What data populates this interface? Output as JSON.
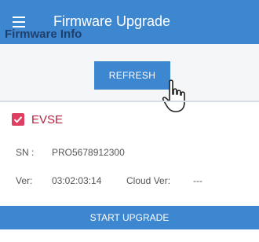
{
  "header": {
    "title": "Firmware Upgrade"
  },
  "firmware_info": {
    "label": "Firmware Info",
    "refresh_label": "REFRESH"
  },
  "device": {
    "name": "EVSE",
    "checked": true,
    "sn_label": "SN :",
    "sn_value": "PRO5678912300",
    "ver_label": "Ver:",
    "ver_value": "03:02:03:14",
    "cloud_ver_label": "Cloud Ver:",
    "cloud_ver_value": "---"
  },
  "actions": {
    "start_upgrade_label": "START UPGRADE"
  },
  "colors": {
    "primary": "#3d86d0",
    "accent": "#e03d62",
    "label": "#1f3f6b"
  },
  "icons": [
    "menu-icon",
    "check-icon",
    "hand-cursor-icon"
  ]
}
